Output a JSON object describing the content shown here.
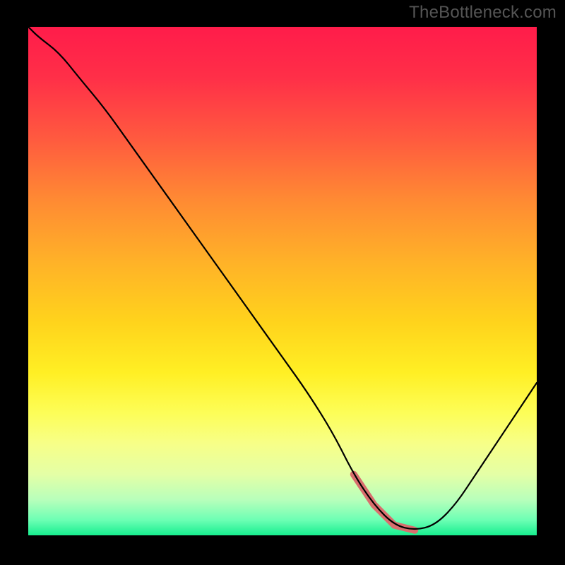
{
  "attribution": "TheBottleneck.com",
  "colors": {
    "frame": "#000000",
    "gradient_top": "#ff1c4a",
    "gradient_bottom": "#17ee8f",
    "line": "#000000",
    "highlight": "#d96e6e"
  },
  "chart_data": {
    "type": "line",
    "title": "",
    "xlabel": "",
    "ylabel": "",
    "xlim": [
      0,
      100
    ],
    "ylim": [
      0,
      100
    ],
    "x": [
      0,
      2,
      6,
      10,
      15,
      20,
      25,
      30,
      35,
      40,
      45,
      50,
      55,
      60,
      64,
      68,
      72,
      76,
      80,
      84,
      88,
      92,
      96,
      100
    ],
    "values": [
      100,
      98,
      95,
      90,
      84,
      77,
      70,
      63,
      56,
      49,
      42,
      35,
      28,
      20,
      12,
      6,
      2,
      1,
      2,
      6,
      12,
      18,
      24,
      30
    ],
    "highlight_range_x": [
      64,
      76
    ]
  }
}
